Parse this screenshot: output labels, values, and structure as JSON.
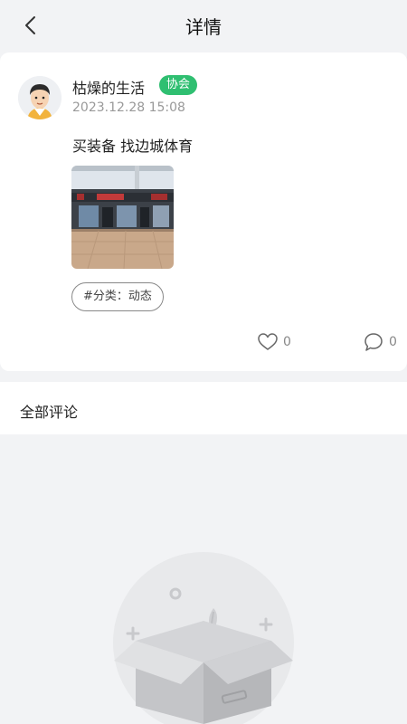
{
  "header": {
    "title": "详情",
    "back_icon": "chevron-left-icon"
  },
  "post": {
    "author": "枯燥的生活",
    "badge": "协会",
    "badge_color": "#2fbf71",
    "time": "2023.12.28 15:08",
    "content": "买装备 找边城体育",
    "category": "#分类：动态",
    "likes": "0",
    "comments": "0"
  },
  "comments": {
    "title": "全部评论",
    "empty_icon": "empty-box-icon"
  }
}
